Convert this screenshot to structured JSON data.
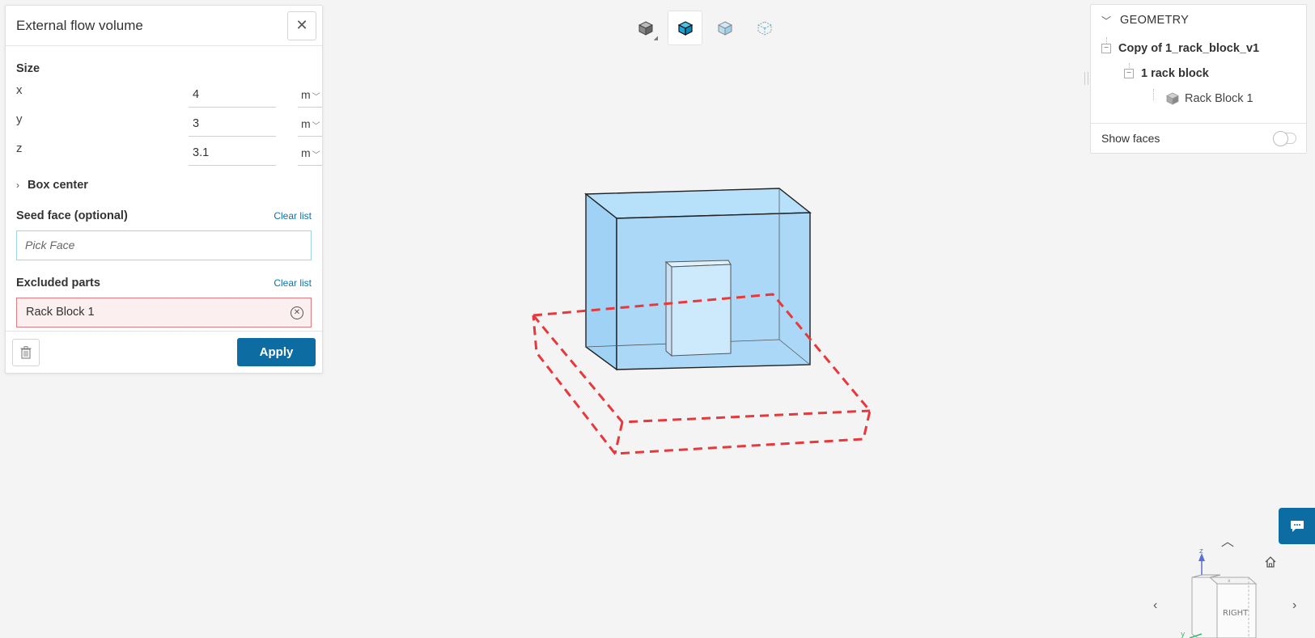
{
  "panel": {
    "title": "External flow volume",
    "size_label": "Size",
    "dimensions": [
      {
        "axis": "x",
        "value": "4",
        "unit": "m"
      },
      {
        "axis": "y",
        "value": "3",
        "unit": "m"
      },
      {
        "axis": "z",
        "value": "3.1",
        "unit": "m"
      }
    ],
    "box_center_label": "Box center",
    "seed_face_label": "Seed face (optional)",
    "seed_face_clear": "Clear list",
    "seed_face_placeholder": "Pick Face",
    "excluded_label": "Excluded parts",
    "excluded_clear": "Clear list",
    "excluded_items": [
      "Rack Block 1"
    ],
    "apply_label": "Apply"
  },
  "geometry": {
    "title": "GEOMETRY",
    "tree": {
      "root": "Copy of 1_rack_block_v1",
      "child": "1 rack block",
      "leaf": "Rack Block 1"
    },
    "show_faces_label": "Show faces",
    "show_faces_on": false
  },
  "nav_cube": {
    "face_label": "RIGHT",
    "axis_z": "z",
    "axis_y": "y",
    "axis_x": "x"
  },
  "colors": {
    "accent": "#0d6da3",
    "volume_fill": "#a6d6f6",
    "box_outline": "#e8383c",
    "excluded_border": "#e57a83"
  }
}
